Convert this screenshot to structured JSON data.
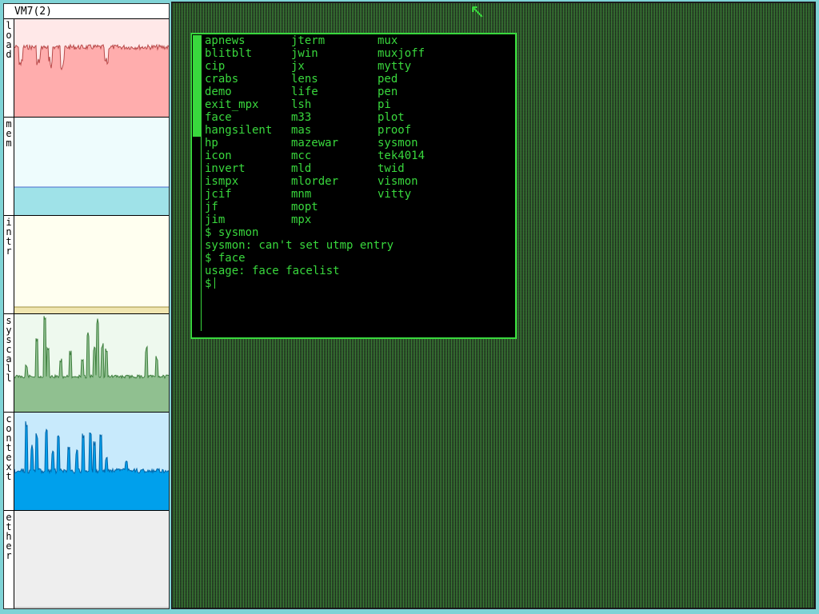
{
  "sysmon": {
    "title": "VM7(2)",
    "meters": [
      {
        "name": "load",
        "label": "load",
        "fill": "#ffadad",
        "bg": "#ffe8e8",
        "line": "#b94a4a"
      },
      {
        "name": "mem",
        "label": "mem",
        "fill": "#9fe2e8",
        "bg": "#eefcfd",
        "line": "#4a6ad0"
      },
      {
        "name": "intr",
        "label": "intr",
        "fill": "#f0e6b0",
        "bg": "#fffff0",
        "line": "#a09040"
      },
      {
        "name": "syscall",
        "label": "syscall",
        "fill": "#90c090",
        "bg": "#eef9ee",
        "line": "#3f7f3f"
      },
      {
        "name": "context",
        "label": "context",
        "fill": "#00a0ec",
        "bg": "#c8eafc",
        "line": "#0066aa"
      },
      {
        "name": "ether",
        "label": "ether",
        "fill": "#eeeeee",
        "bg": "#eeeeee",
        "line": "#aaaaaa"
      }
    ]
  },
  "terminal": {
    "commands": [
      [
        "apnews",
        "jterm",
        "mux"
      ],
      [
        "blitblt",
        "jwin",
        "muxjoff"
      ],
      [
        "cip",
        "jx",
        "mytty"
      ],
      [
        "crabs",
        "lens",
        "ped"
      ],
      [
        "demo",
        "life",
        "pen"
      ],
      [
        "exit_mpx",
        "lsh",
        "pi"
      ],
      [
        "face",
        "m33",
        "plot"
      ],
      [
        "hangsilent",
        "mas",
        "proof"
      ],
      [
        "hp",
        "mazewar",
        "sysmon"
      ],
      [
        "icon",
        "mcc",
        "tek4014"
      ],
      [
        "invert",
        "mld",
        "twid"
      ],
      [
        "ismpx",
        "mlorder",
        "vismon"
      ],
      [
        "jcif",
        "mnm",
        "vitty"
      ],
      [
        "jf",
        "mopt",
        ""
      ],
      [
        "jim",
        "mpx",
        ""
      ]
    ],
    "lines": [
      "$ sysmon",
      "sysmon: can't set utmp entry",
      "$ face",
      "usage: face facelist"
    ],
    "prompt": "$",
    "colors": {
      "text": "#39d83d",
      "background": "#000000"
    }
  },
  "desktop": {
    "background": "#1f1f1f",
    "pattern": "#3f8f3a"
  }
}
